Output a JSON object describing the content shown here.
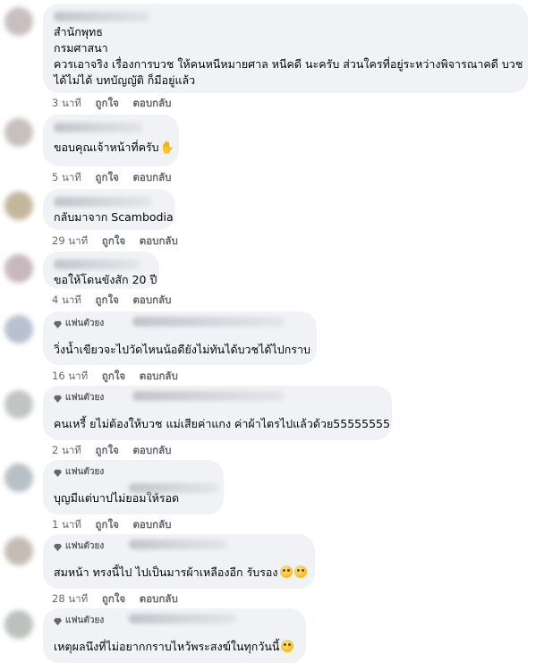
{
  "comments": [
    {
      "badge": "",
      "lines": [
        "สำนักพุทธ",
        "กรมศาสนา",
        "ควรเอาจริง เรื่องการบวช ให้คนหนีหมายศาล หนีคดี นะครับ ส่วนใครที่อยู่ระหว่างพิจารณาคดี บวช",
        "ได้ไม่ได้ บทบัญญัติ ก็มีอยู่แล้ว"
      ],
      "time": "3 นาที",
      "like": "ถูกใจ",
      "reply": "ตอบกลับ"
    },
    {
      "badge": "",
      "lines": [
        "ขอบคุณเจ้าหน้าที่ครับ"
      ],
      "emoji": "thumbs-up",
      "time": "5 นาที",
      "like": "ถูกใจ",
      "reply": "ตอบกลับ"
    },
    {
      "badge": "",
      "lines": [
        "กลับมาจาก Scambodia"
      ],
      "time": "29 นาที",
      "like": "ถูกใจ",
      "reply": "ตอบกลับ"
    },
    {
      "badge": "",
      "lines": [
        "ขอให้โดนขังสัก 20 ปี"
      ],
      "time": "4 นาที",
      "like": "ถูกใจ",
      "reply": "ตอบกลับ"
    },
    {
      "badge": "แฟนตัวยง",
      "lines": [
        "วิ่งน้ำเขียวจะไปวัดไหนน้อดียังไม่ทันได้บวชได้ไปกราบ"
      ],
      "time": "16 นาที",
      "like": "ถูกใจ",
      "reply": "ตอบกลับ"
    },
    {
      "badge": "แฟนตัวยง",
      "lines": [
        "คนเหรี้ ยไม่ต้องให้บวช แม่เสียค่าแกง ค่าผ้าไตรไปแล้วด้วย55555555"
      ],
      "time": "2 นาที",
      "like": "ถูกใจ",
      "reply": "ตอบกลับ"
    },
    {
      "badge": "แฟนตัวยง",
      "lines": [
        "บุญมีแต่บาปไม่ยอมให้รอด"
      ],
      "time": "1 นาที",
      "like": "ถูกใจ",
      "reply": "ตอบกลับ"
    },
    {
      "badge": "แฟนตัวยง",
      "lines": [
        "สมหน้า ทรงนี้ไป ไปเป็นมารผ้าเหลืองอีก รับรอง"
      ],
      "emoji": "grin-sweat",
      "time": "28 นาที",
      "like": "ถูกใจ",
      "reply": "ตอบกลับ"
    },
    {
      "badge": "แฟนตัวยง",
      "lines": [
        "เหตุผลนึงที่ไม่อยากกราบไหว้พระสงฆ์ในทุกวันนี้"
      ],
      "emoji": "grimace",
      "time": "",
      "like": "",
      "reply": ""
    }
  ],
  "colors": {
    "bubble": "#f0f2f5",
    "meta_text": "#65676b",
    "text": "#050505",
    "emoji": "#f7b928"
  }
}
